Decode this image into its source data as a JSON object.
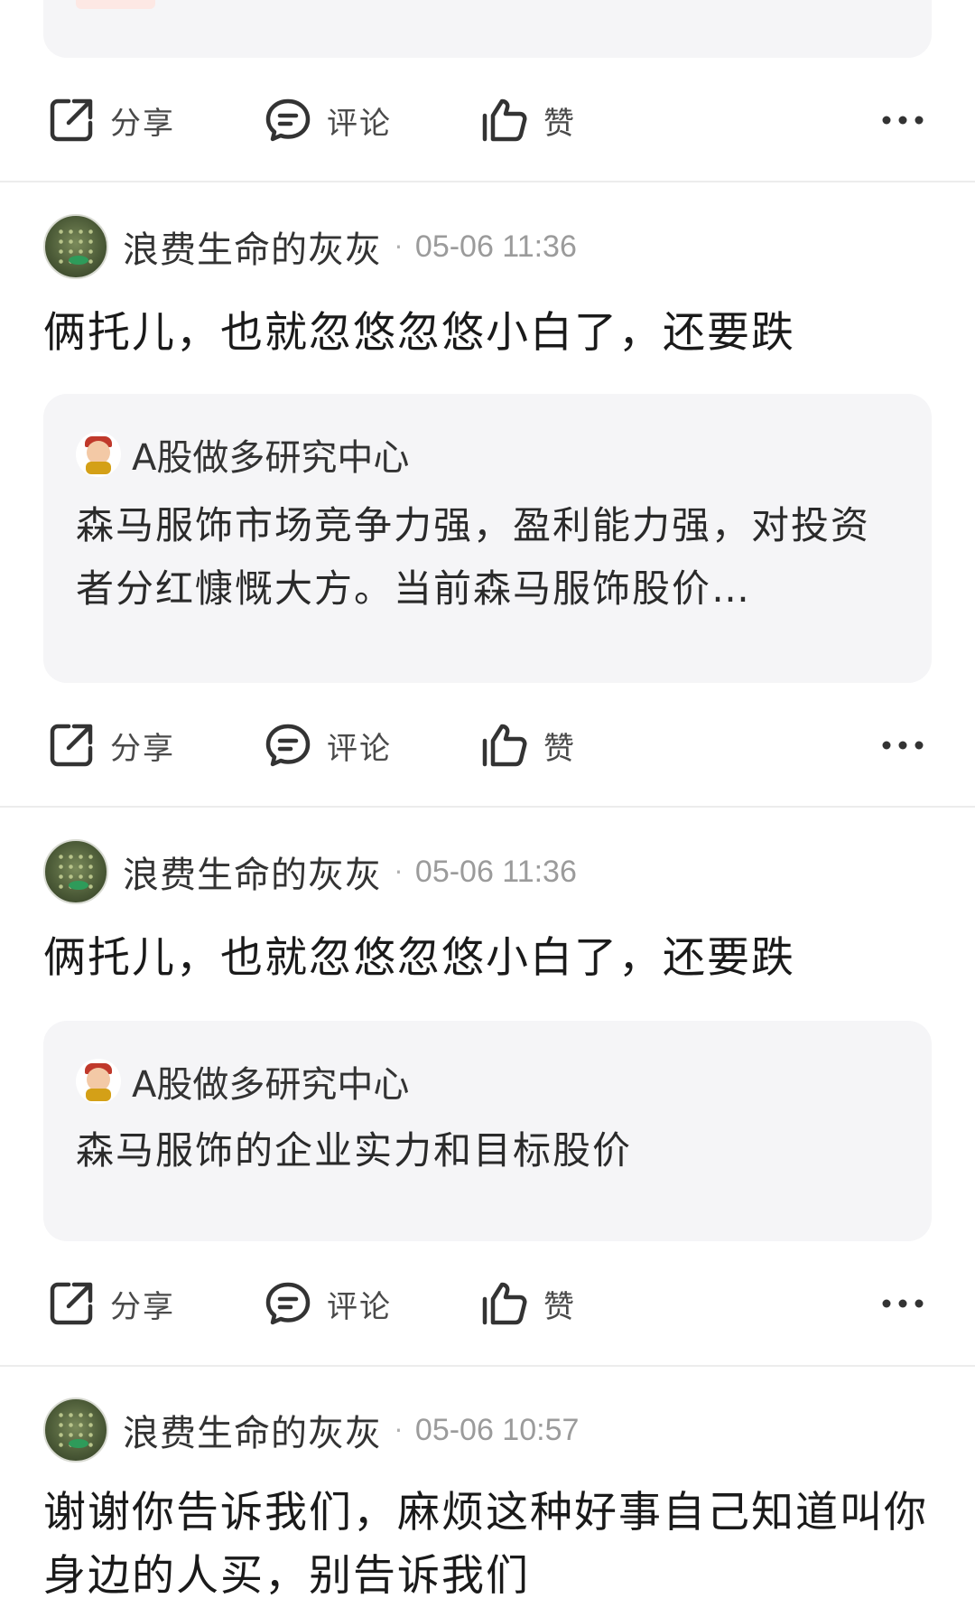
{
  "actions": {
    "share_label": "分享",
    "comment_label": "评论",
    "like_label": "赞"
  },
  "posts": [
    {
      "username": "浪费生命的灰灰",
      "separator": "·",
      "time": "05-06 11:36",
      "text": "俩托儿，也就忽悠忽悠小白了，还要跌",
      "quote": {
        "author": "A股做多研究中心",
        "text": "森马服饰市场竞争力强，盈利能力强，对投资者分红慷慨大方。当前森马服饰股价…"
      }
    },
    {
      "username": "浪费生命的灰灰",
      "separator": "·",
      "time": "05-06 11:36",
      "text": "俩托儿，也就忽悠忽悠小白了，还要跌",
      "quote": {
        "author": "A股做多研究中心",
        "text": "森马服饰的企业实力和目标股价"
      }
    },
    {
      "username": "浪费生命的灰灰",
      "separator": "·",
      "time": "05-06 10:57",
      "text": "谢谢你告诉我们，麻烦这种好事自己知道叫你身边的人买，别告诉我们"
    }
  ]
}
